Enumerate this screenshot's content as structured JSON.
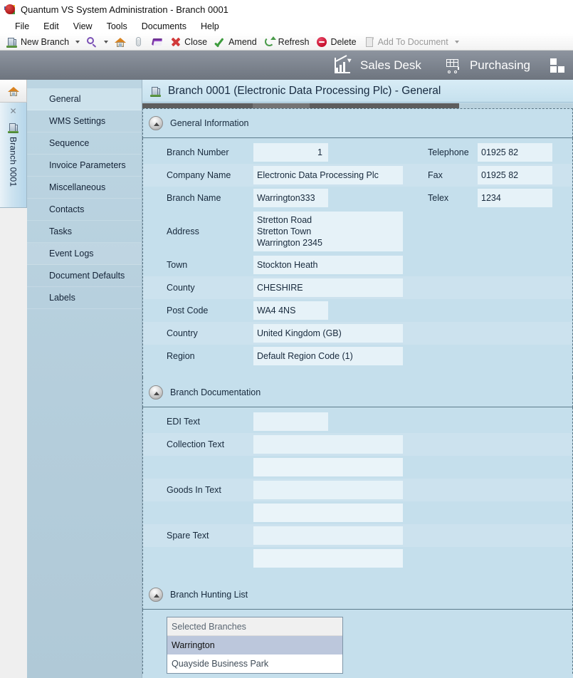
{
  "window": {
    "title": "Quantum VS System Administration -  Branch 0001",
    "app_icon": "quantum-app-icon"
  },
  "menubar": {
    "items": [
      "File",
      "Edit",
      "View",
      "Tools",
      "Documents",
      "Help"
    ]
  },
  "toolbar": {
    "new_branch": "New Branch",
    "close": "Close",
    "amend": "Amend",
    "refresh": "Refresh",
    "delete": "Delete",
    "add_to_document": "Add To Document"
  },
  "navbar": {
    "sales_desk": "Sales Desk",
    "purchasing": "Purchasing"
  },
  "rail": {
    "tab_label": "Branch 0001",
    "close_glyph": "✕"
  },
  "sidebar": {
    "items": [
      "General",
      "WMS Settings",
      "Sequence",
      "Invoice Parameters",
      "Miscellaneous",
      "Contacts",
      "Tasks",
      "Event Logs",
      "Document Defaults",
      "Labels"
    ],
    "active": "General"
  },
  "page": {
    "title": "Branch 0001 (Electronic Data Processing Plc) - General"
  },
  "sections": {
    "general": {
      "title": "General Information",
      "fields": {
        "branch_number_label": "Branch Number",
        "branch_number_value": "1",
        "company_name_label": "Company Name",
        "company_name_value": "Electronic Data Processing Plc",
        "branch_name_label": "Branch Name",
        "branch_name_value": "Warrington333",
        "address_label": "Address",
        "address_value": "Stretton Road\nStretton Town\nWarrington 2345",
        "town_label": "Town",
        "town_value": "Stockton Heath",
        "county_label": "County",
        "county_value": "CHESHIRE",
        "post_code_label": "Post Code",
        "post_code_value": "WA4 4NS",
        "country_label": "Country",
        "country_value": "United Kingdom (GB)",
        "region_label": "Region",
        "region_value": "Default Region Code (1)",
        "telephone_label": "Telephone",
        "telephone_value": "01925 82",
        "fax_label": "Fax",
        "fax_value": "01925 82",
        "telex_label": "Telex",
        "telex_value": "1234"
      }
    },
    "documentation": {
      "title": "Branch Documentation",
      "fields": {
        "edi_text_label": "EDI Text",
        "edi_text_value": "",
        "collection_text_label": "Collection Text",
        "collection_text_value": "",
        "goods_in_text_label": "Goods In Text",
        "goods_in_text_value": "",
        "spare_text_label": "Spare Text",
        "spare_text_value": ""
      }
    },
    "hunting": {
      "title": "Branch Hunting List",
      "column_header": "Selected Branches",
      "rows": [
        "Warrington",
        "Quayside Business Park"
      ],
      "selected": "Warrington"
    }
  },
  "colors": {
    "nav_bar": "#7a818b",
    "content_bg": "#c5dfec",
    "field_bg": "#e6f2f8",
    "sidebar_bg": "#b4cddb",
    "selected_row": "#bcc7dc"
  }
}
